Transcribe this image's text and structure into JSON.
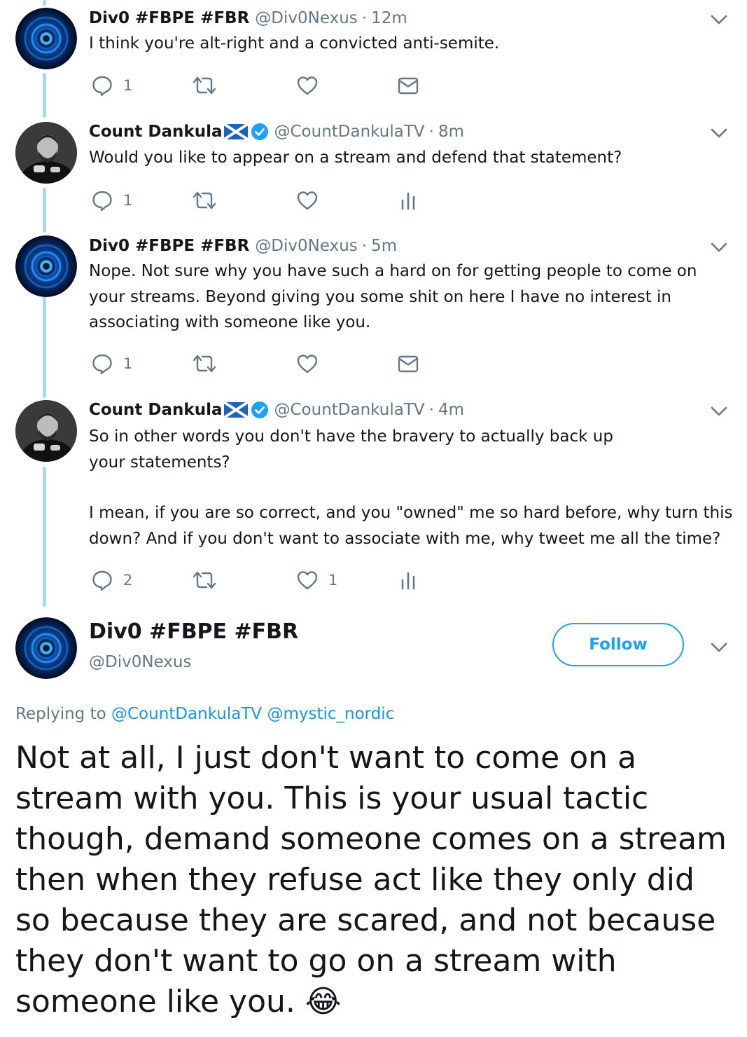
{
  "tweets": [
    {
      "name": "Div0 #FBPE #FBR",
      "handle": "@Div0Nexus",
      "separator": "·",
      "time": "12m",
      "text": [
        "I think you're alt-right and a convicted anti-semite."
      ],
      "reply_count": "1",
      "like_count": "",
      "fourth_action": "envelope-icon"
    },
    {
      "name": "Count Dankula",
      "handle": "@CountDankulaTV",
      "separator": "·",
      "time": "8m",
      "text": [
        "Would you like to appear on a stream and defend that statement?"
      ],
      "reply_count": "1",
      "like_count": "",
      "fourth_action": "analytics-icon"
    },
    {
      "name": "Div0 #FBPE #FBR",
      "handle": "@Div0Nexus",
      "separator": "·",
      "time": "5m",
      "text": [
        "Nope. Not sure why you have such a hard on for getting people to come on your streams. Beyond giving you some shit on here I have no interest in associating with someone like you."
      ],
      "reply_count": "1",
      "like_count": "",
      "fourth_action": "envelope-icon"
    },
    {
      "name": "Count Dankula",
      "handle": "@CountDankulaTV",
      "separator": "·",
      "time": "4m",
      "text": [
        "So in other words you don't have the bravery to actually back up your statements?",
        "I mean, if you are so correct, and you \"owned\" me so hard before, why turn this down? And if you don't want to associate with me, why tweet me all the time?"
      ],
      "reply_count": "2",
      "like_count": "1",
      "fourth_action": "analytics-icon"
    }
  ],
  "main_tweet": {
    "name": "Div0 #FBPE #FBR",
    "handle": "@Div0Nexus",
    "follow_label": "Follow",
    "replying_prefix": "Replying to",
    "replying_to": [
      "@CountDankulaTV",
      "@mystic_nordic"
    ],
    "text": "Not at all, I just don't want to come on a stream with you. This is your usual tactic though, demand someone comes on a stream then when they refuse act like they only did so because they are scared, and not because they don't want to go on a stream with someone like you.",
    "emoji": "😂"
  },
  "colors": {
    "accent": "#1da1f2",
    "text": "#14171a",
    "muted": "#657786",
    "thread_line": "#a9d7f0"
  }
}
